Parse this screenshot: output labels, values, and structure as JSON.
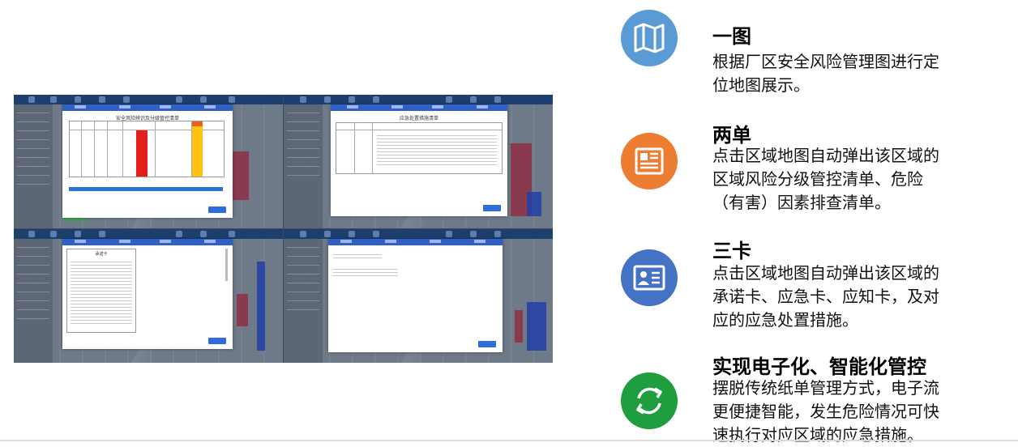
{
  "features": [
    {
      "icon": "map-icon",
      "color": "#5b9bd5",
      "title": "一图",
      "lines": [
        "根据厂区安全风险管理图进行定",
        "位地图展示。"
      ]
    },
    {
      "icon": "document-list-icon",
      "color": "#ed7d31",
      "title": "两单",
      "lines": [
        "点击区域地图自动弹出该区域的",
        "区域风险分级管控清单、危险",
        "（有害）因素排查清单。"
      ]
    },
    {
      "icon": "id-card-icon",
      "color": "#4472c4",
      "title": "三卡",
      "lines": [
        "点击区域地图自动弹出该区域的",
        "承诺卡、应急卡、应知卡，及对",
        "应的应急处置措施。"
      ]
    },
    {
      "icon": "refresh-cycle-icon",
      "color": "#1e9e3e",
      "title": "实现电子化、智能化管控",
      "lines": [
        "摆脱传统纸单管理方式，电子流",
        "更便捷智能，发生危险情况可快",
        "速执行对应区域的应急措施。"
      ]
    }
  ],
  "screenshots": {
    "risk_list_title": "安全风险辨识及分级管控清单",
    "emergency_title": "应急处置措施清单",
    "commitment_card_title": "承诺卡"
  }
}
